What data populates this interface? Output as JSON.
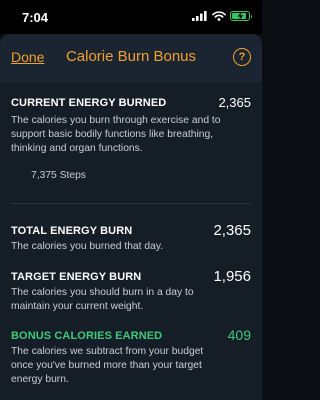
{
  "status_bar": {
    "time": "7:04",
    "battery_level": 0.9
  },
  "nav": {
    "done_label": "Done",
    "title": "Calorie Burn Bonus",
    "help_label": "?"
  },
  "current_energy": {
    "title": "CURRENT ENERGY BURNED",
    "value": "2,365",
    "description": "The calories you burn through exercise and to support basic bodily functions like breathing, thinking and organ functions.",
    "steps": "7,375 Steps"
  },
  "total_energy": {
    "title": "TOTAL ENERGY BURN",
    "value": "2,365",
    "description": "The calories you burned that day."
  },
  "target_energy": {
    "title": "TARGET ENERGY BURN",
    "value": "1,956",
    "description": "The calories you should burn in a day to maintain your current weight."
  },
  "bonus_calories": {
    "title": "BONUS CALORIES EARNED",
    "value": "409",
    "description": "The calories we subtract from your budget once you've burned more than your target energy burn."
  },
  "colors": {
    "accent": "#f0a030",
    "bonus": "#3ec97a",
    "battery": "#34c759"
  }
}
